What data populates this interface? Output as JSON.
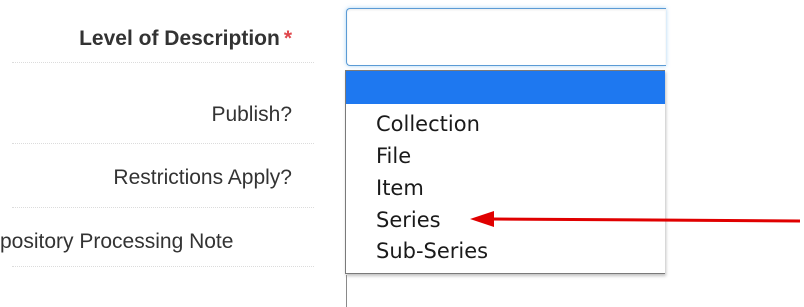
{
  "form": {
    "level_label": "Level of Description",
    "required_marker": "*",
    "publish_label": "Publish?",
    "restrictions_label": "Restrictions Apply?",
    "processing_note_label": "pository Processing Note"
  },
  "select": {
    "value": "",
    "options": [
      "",
      "Collection",
      "File",
      "Item",
      "Series",
      "Sub-Series"
    ],
    "highlighted_option": ""
  },
  "annotation": {
    "arrow_color": "#e00000",
    "points_to": "Series"
  },
  "colors": {
    "required_star": "#e0474c",
    "focus_border": "#5b9bd5",
    "highlight": "#1e78f0"
  }
}
